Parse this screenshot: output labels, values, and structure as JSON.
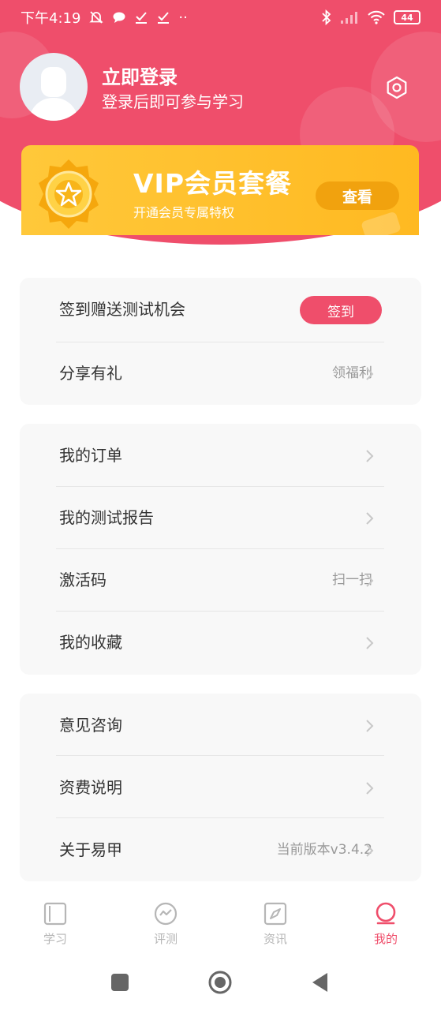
{
  "status_bar": {
    "time": "下午4:19",
    "dots": "··",
    "battery": "44"
  },
  "profile": {
    "login_title": "立即登录",
    "login_subtitle": "登录后即可参与学习"
  },
  "vip": {
    "title": "VIP会员套餐",
    "subtitle": "开通会员专属特权",
    "button": "查看"
  },
  "card1": {
    "rows": [
      {
        "label": "签到赠送测试机会",
        "button": "签到"
      },
      {
        "label": "分享有礼",
        "right": "领福利"
      }
    ]
  },
  "card2": {
    "rows": [
      {
        "label": "我的订单",
        "right": ""
      },
      {
        "label": "我的测试报告",
        "right": ""
      },
      {
        "label": "激活码",
        "right": "扫一扫"
      },
      {
        "label": "我的收藏",
        "right": ""
      }
    ]
  },
  "card3": {
    "rows": [
      {
        "label": "意见咨询",
        "right": ""
      },
      {
        "label": "资费说明",
        "right": ""
      },
      {
        "label": "关于易甲",
        "right": "当前版本v3.4.2"
      }
    ]
  },
  "tabbar": {
    "tabs": [
      {
        "label": "学习",
        "icon": "book-icon"
      },
      {
        "label": "评测",
        "icon": "chat-icon"
      },
      {
        "label": "资讯",
        "icon": "compass-icon"
      },
      {
        "label": "我的",
        "icon": "profile-icon"
      }
    ],
    "active_tab": "我的"
  },
  "colors": {
    "accent": "#ef4e6b",
    "vip_gold": "#ffc83a",
    "card_bg": "#f8f8f8"
  }
}
